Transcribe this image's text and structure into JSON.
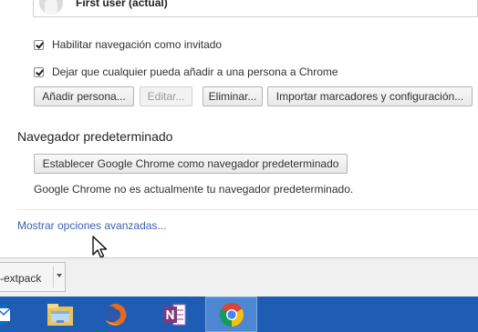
{
  "profiles": {
    "current_user": "First user (actual)"
  },
  "options": {
    "guest_browsing": "Habilitar navegación como invitado",
    "add_person": "Dejar que cualquier pueda añadir a una persona a Chrome"
  },
  "people_buttons": {
    "add": "Añadir persona...",
    "edit": "Editar...",
    "remove": "Eliminar...",
    "import": "Importar marcadores y configuración..."
  },
  "default_browser": {
    "title": "Navegador predeterminado",
    "button": "Establecer Google Chrome como navegador predeterminado",
    "status": "Google Chrome no es actualmente tu navegador predeterminado."
  },
  "advanced_link": "Mostrar opciones avanzadas...",
  "download_shelf": {
    "item_name": "-extpack"
  },
  "taskbar": {
    "apps": [
      "outlook-icon",
      "file-explorer-icon",
      "firefox-icon",
      "onenote-icon",
      "chrome-icon"
    ]
  },
  "colors": {
    "link": "#3b62b5",
    "taskbar": "#1f5db5"
  }
}
